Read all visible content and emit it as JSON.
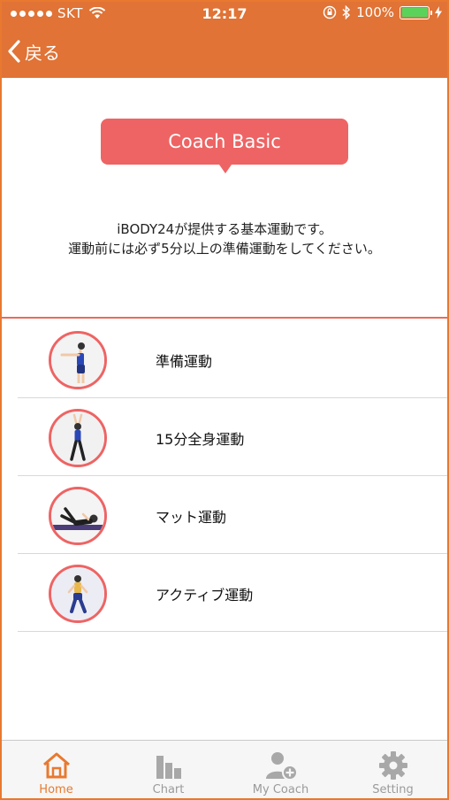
{
  "status_bar": {
    "carrier": "SKT",
    "time": "12:17",
    "battery": "100%"
  },
  "nav": {
    "back_label": "戻る"
  },
  "header": {
    "title": "Coach Basic",
    "description_line1": "iBODY24が提供する基本運動です。",
    "description_line2": "運動前には必ず5分以上の準備運動をしてください。"
  },
  "exercises": [
    {
      "label": "準備運動"
    },
    {
      "label": "15分全身運動"
    },
    {
      "label": "マット運動"
    },
    {
      "label": "アクティブ運動"
    }
  ],
  "tabs": [
    {
      "label": "Home",
      "icon": "home-icon",
      "active": true
    },
    {
      "label": "Chart",
      "icon": "chart-icon",
      "active": false
    },
    {
      "label": "My Coach",
      "icon": "add-user-icon",
      "active": false
    },
    {
      "label": "Setting",
      "icon": "gear-icon",
      "active": false
    }
  ],
  "colors": {
    "accent": "#E07335",
    "coach_badge": "#EE6464",
    "battery": "#5BD35B"
  }
}
